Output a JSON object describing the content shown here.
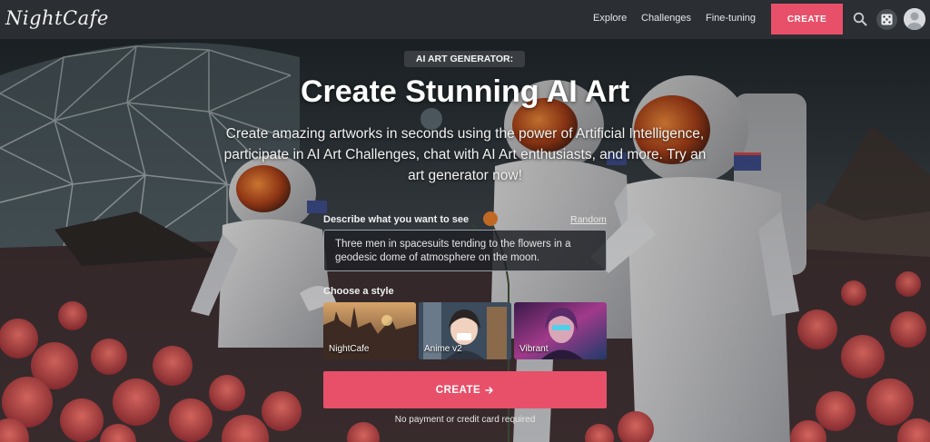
{
  "app": {
    "logo": "NightCafe"
  },
  "nav": {
    "links": [
      "Explore",
      "Challenges",
      "Fine-tuning"
    ],
    "create_label": "CREATE"
  },
  "hero": {
    "badge": "AI ART GENERATOR:",
    "headline": "Create Stunning AI Art",
    "subhead": "Create amazing artworks in seconds using the power of Artificial Intelligence, participate in AI Art Challenges, chat with AI Art enthusiasts, and more. Try an art generator now!"
  },
  "form": {
    "prompt_label": "Describe what you want to see",
    "random_label": "Random",
    "prompt_value": "Three men in spacesuits tending to the flowers in a geodesic dome of atmosphere on the moon.",
    "style_label": "Choose a style",
    "styles": [
      {
        "name": "NightCafe",
        "selected": false
      },
      {
        "name": "Anime v2",
        "selected": true
      },
      {
        "name": "Vibrant",
        "selected": false
      }
    ],
    "create_label": "CREATE",
    "note": "No payment or credit card required"
  },
  "colors": {
    "accent": "#e8506a",
    "navbar": "#2b2e33",
    "selected_outline": "#5ab4e6"
  },
  "icons": [
    "search-icon",
    "dice-icon",
    "avatar-icon",
    "arrow-right-icon"
  ]
}
